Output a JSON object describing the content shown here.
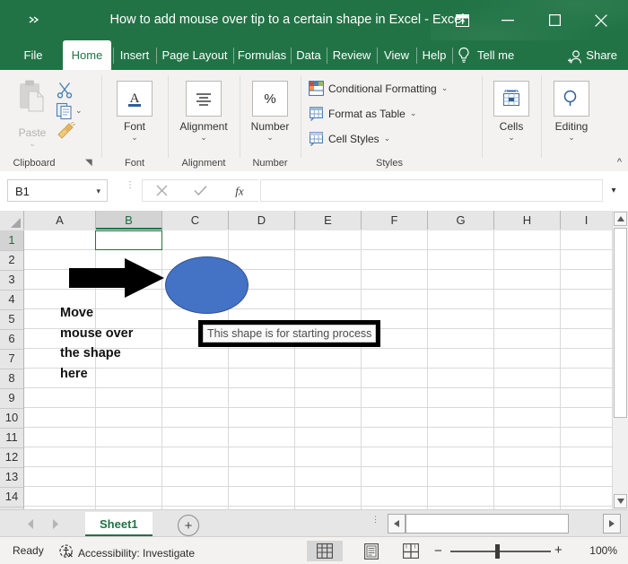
{
  "window": {
    "title": "How to add mouse over tip to a certain shape in Excel  -  Excel",
    "qat_overflow_label": "»",
    "controls": [
      {
        "name": "ribbon-display-options",
        "label": "Ribbon Display Options"
      },
      {
        "name": "minimize",
        "label": "Minimize"
      },
      {
        "name": "restore",
        "label": "Restore Down"
      },
      {
        "name": "close",
        "label": "Close"
      }
    ],
    "accent_color": "#217346"
  },
  "ribbon": {
    "tabs": [
      {
        "label": "File",
        "active": false
      },
      {
        "label": "Home",
        "active": true
      },
      {
        "label": "Insert",
        "active": false
      },
      {
        "label": "Page Layout",
        "active": false
      },
      {
        "label": "Formulas",
        "active": false
      },
      {
        "label": "Data",
        "active": false
      },
      {
        "label": "Review",
        "active": false
      },
      {
        "label": "View",
        "active": false
      },
      {
        "label": "Help",
        "active": false
      }
    ],
    "tell_me": "Tell me",
    "share": "Share",
    "groups": {
      "clipboard": {
        "label": "Clipboard",
        "paste": "Paste",
        "paste_chevron": "⌄",
        "items": [
          "cut-icon",
          "copy-icon",
          "format-painter-icon"
        ],
        "dialog_launcher": "◥"
      },
      "font": {
        "label": "Font",
        "caption": "Font",
        "chevron": "⌄",
        "icon": "font-A-icon"
      },
      "alignment": {
        "label": "Alignment",
        "caption": "Alignment",
        "chevron": "⌄",
        "icon": "align-center-icon"
      },
      "number": {
        "label": "Number",
        "caption": "Number",
        "chevron": "⌄",
        "icon": "percent-icon"
      },
      "styles": {
        "label": "Styles",
        "rows": [
          {
            "label": "Conditional Formatting",
            "chevron": "⌄",
            "icon": "conditional-formatting-icon"
          },
          {
            "label": "Format as Table",
            "chevron": "⌄",
            "icon": "format-as-table-icon"
          },
          {
            "label": "Cell Styles",
            "chevron": "⌄",
            "icon": "cell-styles-icon"
          }
        ]
      },
      "cells": {
        "label": "",
        "caption": "Cells",
        "chevron": "⌄",
        "icon": "cells-insert-icon"
      },
      "editing": {
        "label": "",
        "caption": "Editing",
        "chevron": "⌄",
        "icon": "editing-find-icon"
      }
    },
    "collapse_label": "^"
  },
  "formula_bar": {
    "name_box_value": "B1",
    "name_box_chevron": "▾",
    "cancel_label": "✕",
    "enter_label": "✓",
    "fx_label": "fx",
    "formula_value": "",
    "expand_chevron": "▾"
  },
  "grid": {
    "columns": [
      "A",
      "B",
      "C",
      "D",
      "E",
      "F",
      "G",
      "H",
      "I"
    ],
    "rows": [
      "1",
      "2",
      "3",
      "4",
      "5",
      "6",
      "7",
      "8",
      "9",
      "10",
      "11",
      "12",
      "13",
      "14"
    ],
    "selected_cell": "B1",
    "selected_column": "B",
    "selected_row": "1"
  },
  "canvas": {
    "ellipse": {
      "name": "oval-shape",
      "fill": "#4472C4",
      "stroke": "#2F528F"
    },
    "arrow": {
      "name": "black-right-arrow",
      "fill": "#000000"
    },
    "annotation": [
      "Move",
      "mouse over",
      "the shape",
      "here"
    ],
    "tooltip": {
      "text": "This shape is for starting process",
      "border": "#000000",
      "bg": "#FAFAFA"
    }
  },
  "sheet_tabs": {
    "prev_label": "◀",
    "next_label": "▶",
    "tabs": [
      "Sheet1"
    ],
    "active": "Sheet1",
    "add_label": "+"
  },
  "status_bar": {
    "mode": "Ready",
    "accessibility": "Accessibility: Investigate",
    "views": [
      {
        "name": "normal-view",
        "label": "Normal",
        "active": true
      },
      {
        "name": "page-layout-view",
        "label": "Page Layout",
        "active": false
      },
      {
        "name": "page-break-preview",
        "label": "Page Break Preview",
        "active": false
      }
    ],
    "zoom_out": "−",
    "zoom_in": "+",
    "zoom_level": "100%"
  }
}
